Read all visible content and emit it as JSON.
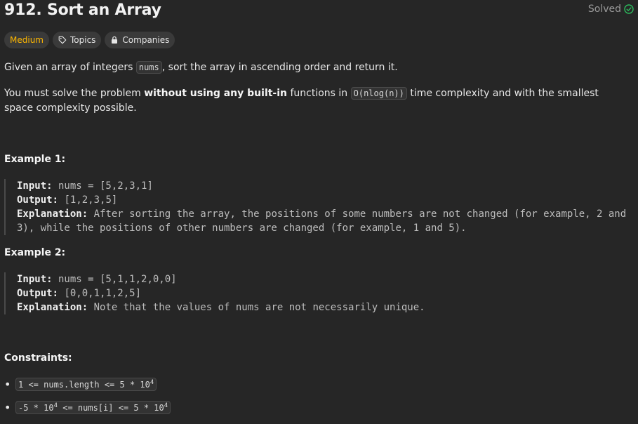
{
  "problem": {
    "title": "912. Sort an Array",
    "status": "Solved"
  },
  "tags": {
    "difficulty": "Medium",
    "topics": "Topics",
    "companies": "Companies"
  },
  "description": {
    "p1_a": "Given an array of integers ",
    "p1_code": "nums",
    "p1_b": ", sort the array in ascending order and return it.",
    "p2_a": "You must solve the problem ",
    "p2_bold": "without using any built-in",
    "p2_b": " functions in ",
    "p2_code": "O(nlog(n))",
    "p2_c": " time complexity and with the smallest space complexity possible."
  },
  "examples": [
    {
      "heading": "Example 1:",
      "input_label": "Input:",
      "input": " nums = [5,2,3,1]",
      "output_label": "Output:",
      "output": " [1,2,3,5]",
      "explanation_label": "Explanation:",
      "explanation": " After sorting the array, the positions of some numbers are not changed (for example, 2 and 3), while the positions of other numbers are changed (for example, 1 and 5)."
    },
    {
      "heading": "Example 2:",
      "input_label": "Input:",
      "input": " nums = [5,1,1,2,0,0]",
      "output_label": "Output:",
      "output": " [0,0,1,1,2,5]",
      "explanation_label": "Explanation:",
      "explanation": " Note that the values of nums are not necessarily unique."
    }
  ],
  "constraints": {
    "heading": "Constraints:",
    "c1_a": "1 <= nums.length <= 5 * 10",
    "c1_sup": "4",
    "c2_a": "-5 * 10",
    "c2_sup1": "4",
    "c2_b": " <= nums[i] <= 5 * 10",
    "c2_sup2": "4"
  }
}
